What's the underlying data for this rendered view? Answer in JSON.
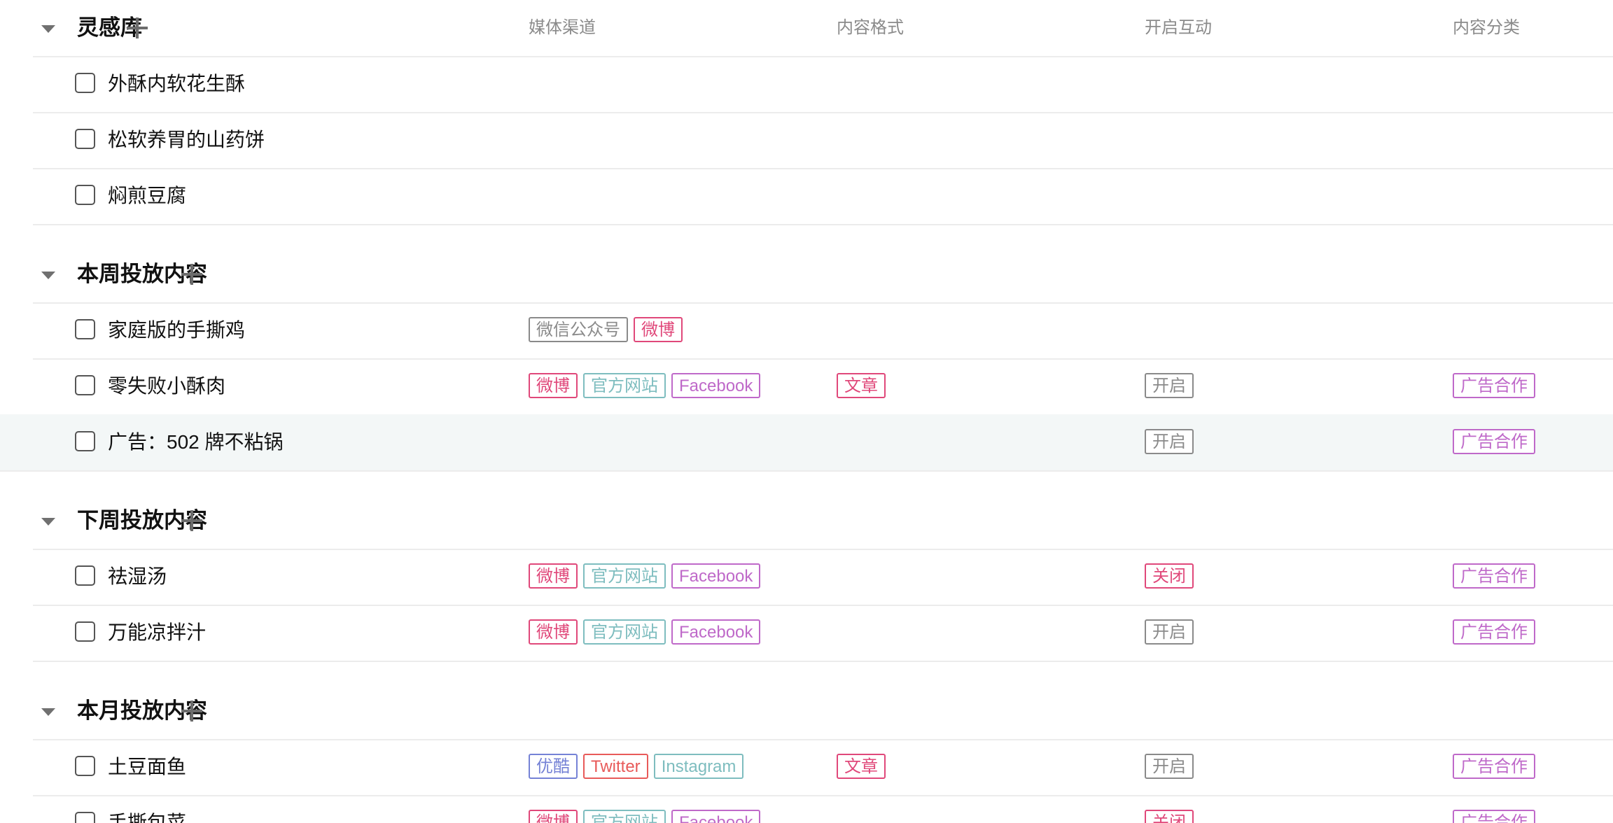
{
  "columns": [
    "媒体渠道",
    "内容格式",
    "开启互动",
    "内容分类"
  ],
  "colors": {
    "gray": "#8a8a8a",
    "pink": "#e0487a",
    "teal": "#7ebdbf",
    "purple": "#bf69c9",
    "indigo": "#7582d6",
    "red": "#e85a59"
  },
  "groups": [
    {
      "title": "灵感库",
      "show_columns": true,
      "rows": [
        {
          "title": "外酥内软花生酥",
          "media": [],
          "format": [],
          "interaction": [],
          "category": []
        },
        {
          "title": "松软养胃的山药饼",
          "media": [],
          "format": [],
          "interaction": [],
          "category": []
        },
        {
          "title": "焖煎豆腐",
          "media": [],
          "format": [],
          "interaction": [],
          "category": []
        }
      ]
    },
    {
      "title": "本周投放内容",
      "show_columns": false,
      "rows": [
        {
          "title": "家庭版的手撕鸡",
          "media": [
            {
              "label": "微信公众号",
              "color": "gray"
            },
            {
              "label": "微博",
              "color": "pink"
            }
          ],
          "format": [],
          "interaction": [],
          "category": []
        },
        {
          "title": "零失败小酥肉",
          "media": [
            {
              "label": "微博",
              "color": "pink"
            },
            {
              "label": "官方网站",
              "color": "teal"
            },
            {
              "label": "Facebook",
              "color": "purple"
            }
          ],
          "format": [
            {
              "label": "文章",
              "color": "pink"
            }
          ],
          "interaction": [
            {
              "label": "开启",
              "color": "gray"
            }
          ],
          "category": [
            {
              "label": "广告合作",
              "color": "purple"
            }
          ]
        },
        {
          "title": "广告：502 牌不粘锅",
          "highlight": true,
          "media": [],
          "format": [],
          "interaction": [
            {
              "label": "开启",
              "color": "gray"
            }
          ],
          "category": [
            {
              "label": "广告合作",
              "color": "purple"
            }
          ]
        }
      ]
    },
    {
      "title": "下周投放内容",
      "show_columns": false,
      "rows": [
        {
          "title": "祛湿汤",
          "media": [
            {
              "label": "微博",
              "color": "pink"
            },
            {
              "label": "官方网站",
              "color": "teal"
            },
            {
              "label": "Facebook",
              "color": "purple"
            }
          ],
          "format": [],
          "interaction": [
            {
              "label": "关闭",
              "color": "pink"
            }
          ],
          "category": [
            {
              "label": "广告合作",
              "color": "purple"
            }
          ]
        },
        {
          "title": "万能凉拌汁",
          "media": [
            {
              "label": "微博",
              "color": "pink"
            },
            {
              "label": "官方网站",
              "color": "teal"
            },
            {
              "label": "Facebook",
              "color": "purple"
            }
          ],
          "format": [],
          "interaction": [
            {
              "label": "开启",
              "color": "gray"
            }
          ],
          "category": [
            {
              "label": "广告合作",
              "color": "purple"
            }
          ]
        }
      ]
    },
    {
      "title": "本月投放内容",
      "show_columns": false,
      "rows": [
        {
          "title": "土豆面鱼",
          "media": [
            {
              "label": "优酷",
              "color": "indigo"
            },
            {
              "label": "Twitter",
              "color": "red"
            },
            {
              "label": "Instagram",
              "color": "teal"
            }
          ],
          "format": [
            {
              "label": "文章",
              "color": "pink"
            }
          ],
          "interaction": [
            {
              "label": "开启",
              "color": "gray"
            }
          ],
          "category": [
            {
              "label": "广告合作",
              "color": "purple"
            }
          ]
        },
        {
          "title": "手撕包菜",
          "media": [
            {
              "label": "微博",
              "color": "pink"
            },
            {
              "label": "官方网站",
              "color": "teal"
            },
            {
              "label": "Facebook",
              "color": "purple"
            }
          ],
          "format": [],
          "interaction": [
            {
              "label": "关闭",
              "color": "pink"
            }
          ],
          "category": [
            {
              "label": "广告合作",
              "color": "purple"
            }
          ]
        }
      ]
    }
  ]
}
